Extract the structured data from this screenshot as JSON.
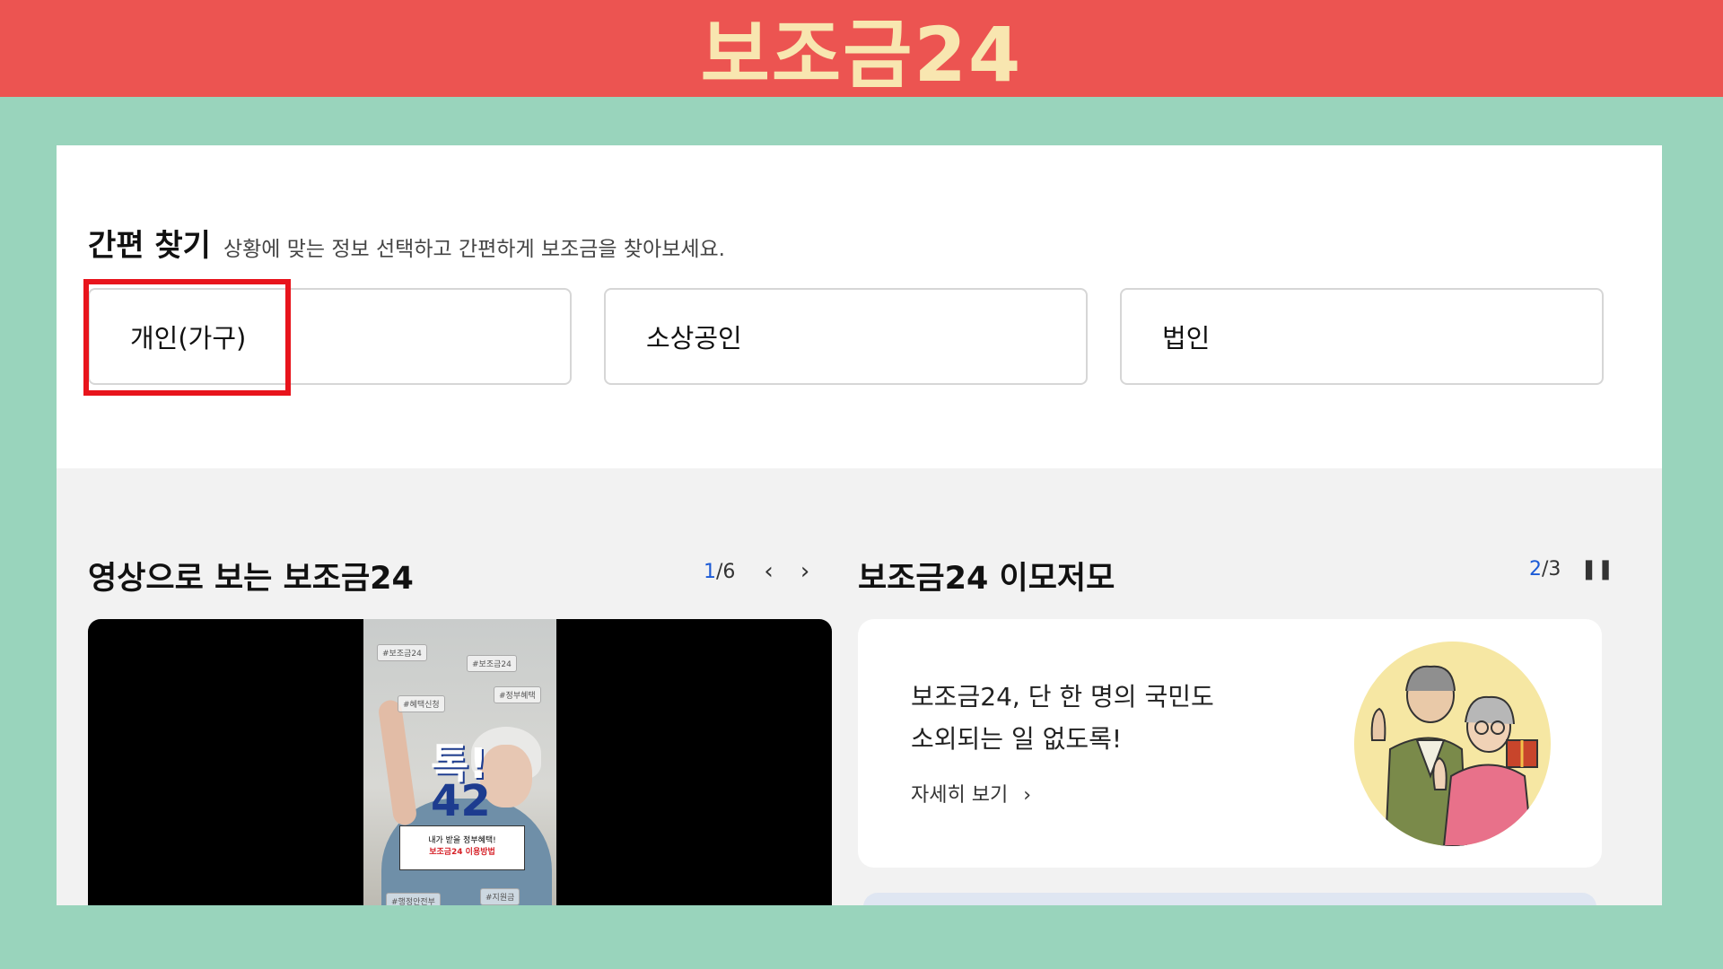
{
  "banner": {
    "title": "보조금24"
  },
  "quick_find": {
    "title": "간편 찾기",
    "description": "상황에 맞는 정보 선택하고 간편하게 보조금을 찾아보세요.",
    "categories": [
      {
        "label": "개인(가구)"
      },
      {
        "label": "소상공인"
      },
      {
        "label": "법인"
      }
    ],
    "highlight_color": "#e8141c"
  },
  "video_section": {
    "title": "영상으로 보는 보조금24",
    "pager_current": "1",
    "pager_total": "/6",
    "prev_icon": "chevron-left-icon",
    "next_icon": "chevron-right-icon",
    "thumbnail": {
      "tags": [
        "#보조금24",
        "#보조금24",
        "#혜택신청",
        "#정부혜택",
        "#행정안전부",
        "#지원금"
      ],
      "big_text_1": "톡!",
      "big_text_2": "42",
      "caption_line1": "내가 받을 정부혜택!",
      "caption_line2": "보조금24 이용방법"
    }
  },
  "info_section": {
    "title": "보조금24 이모저모",
    "pager_current": "2",
    "pager_total": "/3",
    "pause_icon": "pause-icon",
    "card": {
      "line1": "보조금24, 단 한 명의 국민도",
      "line2": "소외되는 일 없도록!",
      "more_label": "자세히 보기",
      "more_icon": "chevron-right-icon"
    }
  },
  "colors": {
    "banner_bg": "#ec5451",
    "banner_text": "#f8e6b0",
    "frame_bg": "#99d4bc",
    "pager_accent": "#1c5bd6"
  }
}
